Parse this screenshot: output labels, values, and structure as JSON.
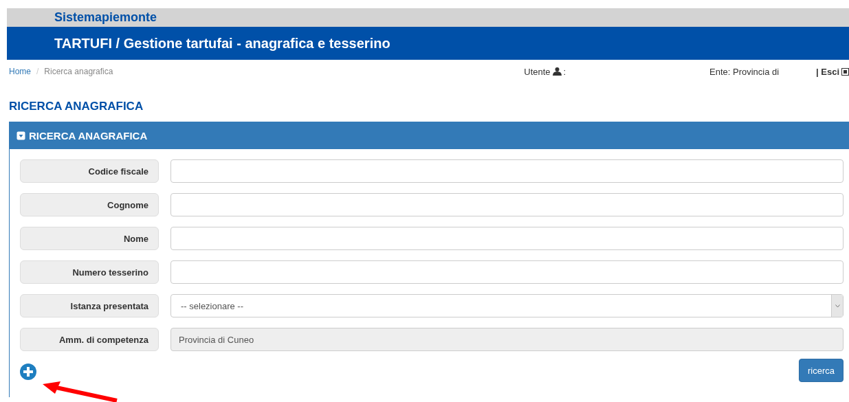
{
  "brand": "Sistemapiemonte",
  "app_title": "TARTUFI / Gestione tartufai - anagrafica e tesserino",
  "breadcrumb_separator": "/",
  "breadcrumb": [
    {
      "label": "Home",
      "kind": "link"
    },
    {
      "label": "Ricerca anagrafica",
      "kind": "current"
    }
  ],
  "user": {
    "label": "Utente",
    "suffix": ":"
  },
  "ente": "Ente: Provincia di",
  "logout": "| Esci",
  "page_title": "RICERCA ANAGRAFICA",
  "panel": {
    "title": "RICERCA ANAGRAFICA",
    "expanded": true,
    "fields": [
      {
        "label": "Codice fiscale",
        "kind": "text"
      },
      {
        "label": "Cognome",
        "kind": "text"
      },
      {
        "label": "Nome",
        "kind": "text"
      },
      {
        "label": "Numero tesserino",
        "kind": "text"
      },
      {
        "label": "Istanza presentata",
        "kind": "select",
        "value": "-- selezionare --"
      },
      {
        "label": "Amm. di competenza",
        "kind": "readonly",
        "value": "Provincia di Cuneo"
      }
    ],
    "search_button": "ricerca"
  }
}
